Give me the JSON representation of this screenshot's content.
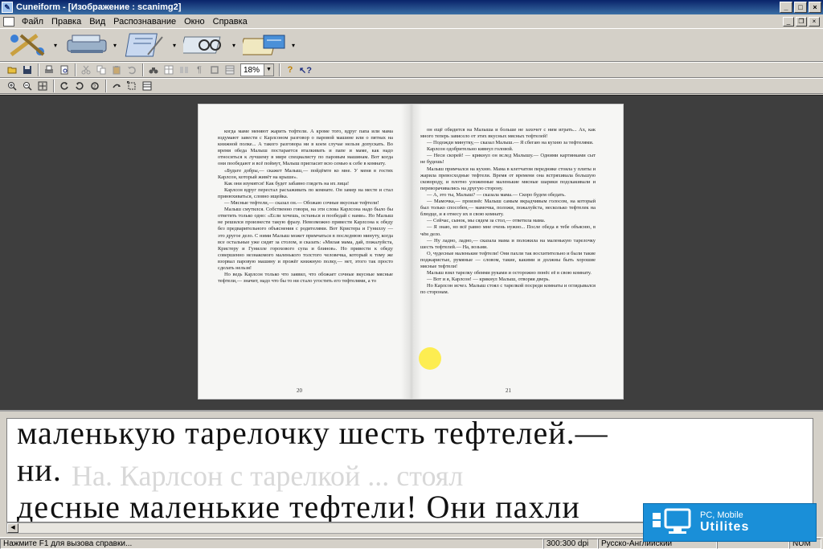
{
  "window": {
    "title": "Cuneiform - [Изображение : scanimg2]"
  },
  "menu": [
    "Файл",
    "Правка",
    "Вид",
    "Распознавание",
    "Окно",
    "Справка"
  ],
  "toolbar": {
    "zoom": "18%"
  },
  "scan": {
    "left_page": [
      "когда маме меняют жарить тефтели. А кроме того, вдруг папа или мама вздумают завести с Карлсоном разговор о паровой машине или о пятнах на книжной полке... А такого разговора ни в коем случае нельзя допускать. Во время обеда Малыш постарается вталкивать и папе и маме, как надо относиться к лучшему в мире специалисту по паровым машинам. Вот когда они пообедают и всё поймут, Малыш пригласит всю семью к себе в комнату.",
      "«Будьте добры,— скажет Малыш,— пойдёмте ко мне. У меня в гостях Карлсон, который живёт на крыше».",
      "Как они изумятся! Как будет забавно глядеть на их лица!",
      "Карлсон вдруг перестал расхаживать по комнате. Он замер на месте и стал принюхиваться, словно ищейка.",
      "— Мясные тефтели,— сказал он.— Обожаю сочные вкусные тефтели!",
      "Малыш смутился. Собственно говоря, на эти слова Карлсона надо было бы ответить только одно: «Если хочешь, останься и пообедай с нами». Но Малыш не решился произнести такую фразу. Невозможно привести Карлсона к обеду без предварительного объяснения с родителями. Вот Кристера и Гуниллу — это другое дело. С ними Малыш может примчаться в последнюю минуту, когда все остальные уже сидят за столом, и сказать: «Милая мама, дай, пожалуйста, Кристеру и Гунилле горохового супа и блинов». Но привести к обеду совершенно незнакомого маленького толстого человечка, который к тому же взорвал паровую машину и прожёг книжную полку,— нет, этого так просто сделать нельзя!",
      "Но ведь Карлсон только что заявил, что обожает сочные вкусные мясные тефтели,— значит, надо что бы то ни стало угостить его тефтелями, а то"
    ],
    "right_page": [
      "он ещё обидится на Малыша и больше не захочет с ним играть... Ах, как много теперь зависело от этих вкусных мясных тефтелей!",
      "— Подожди минутку,— сказал Малыш.— Я сбегаю на кухню за тефтелями.",
      "Карлсон одобрительно кивнул головой.",
      "— Неси скорей! — крикнул он вслед Малышу.— Одними картинками сыт не будешь!",
      "Малыш примчался на кухню. Мама в клетчатом переднике стояла у плиты и жарила превосходные тефтели. Время от времени она встряхивала большую сковороду, и плотно уложенные маленькие мясные шарики подскакивали и переворачивались на другую сторону.",
      "— А, это ты, Малыш? — сказала мама.— Скоро будем обедать.",
      "— Мамочка,— произнёс Малыш самым вкрадчивым голосом, на который был только способен,— мамочка, положи, пожалуйста, несколько тефтелек на блюдце, и я отнесу их в свою комнату.",
      "— Сейчас, сынок, мы сядем за стол,— ответила мама.",
      "— Я знаю, но всё равно мне очень нужно... После обеда я тебе объясню, в чём дело.",
      "— Ну ладно, ладно,— сказала мама и положила на маленькую тарелочку шесть тефтелей.— На, возьми.",
      "О, чудесные маленькие тефтели! Они пахли так восхитительно и были такие поджаристые, румяные — словом, такие, какими и должны быть хорошие мясные тефтели!",
      "Малыш взял тарелку обеими руками и осторожно понёс её в свою комнату.",
      "— Вот и я, Карлсон! — крикнул Малыш, отворяя дверь.",
      "Но Карлсон исчез. Малыш стоял с тарелкой посреди комнаты и оглядывался по сторонам."
    ],
    "page_left_num": "20",
    "page_right_num": "21"
  },
  "recognized": {
    "lines": [
      "маленькую тарелочку шесть тефтелей.—",
      "ни.",
      "десные маленькие тефтели! Они пахли"
    ],
    "ghost": "На. Карлсон с тарелкой ... стоял"
  },
  "status": {
    "help": "Нажмите F1 для вызова справки...",
    "dpi": "300:300 dpi",
    "language": "Русско-Английский",
    "num": "NUM"
  },
  "watermark": {
    "line1": "PC, Mobile",
    "line2": "Utilites"
  },
  "colors": {
    "titlebar": "#0a246a",
    "pane_bg": "#3e3e3e",
    "badge": "#1a8fd8"
  }
}
